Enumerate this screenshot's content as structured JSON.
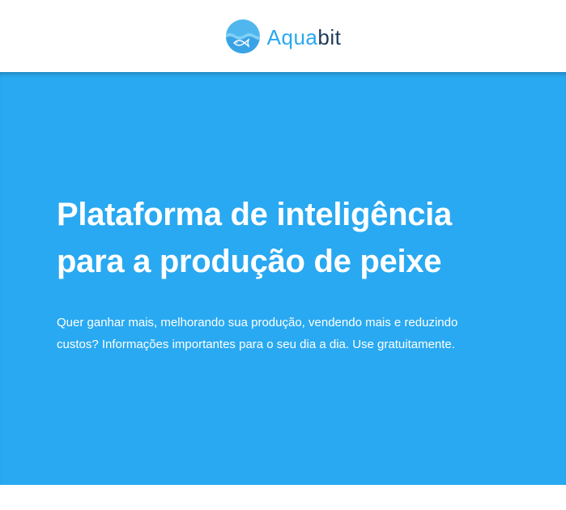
{
  "header": {
    "logo": {
      "icon": "fish-logo-icon",
      "text_part_a": "Aqua",
      "text_part_b": "bit"
    }
  },
  "hero": {
    "title_line1": "Plataforma de inteligência",
    "title_line2": "para a produção de peixe",
    "subtitle_line1": "Quer ganhar mais, melhorando sua produção, vendendo mais e reduzindo",
    "subtitle_line2": "custos? Informações importantes para o seu dia a dia. Use gratuitamente."
  },
  "colors": {
    "hero_background": "#29a9f1",
    "logo_light": "#29a8f0",
    "logo_dark": "#1e3a5a"
  }
}
